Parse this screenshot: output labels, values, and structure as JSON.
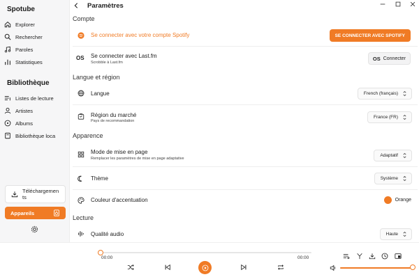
{
  "sidebar": {
    "app_title": "Spotube",
    "nav": [
      {
        "label": "Explorer",
        "icon": "home-icon"
      },
      {
        "label": "Rechercher",
        "icon": "search-icon"
      },
      {
        "label": "Paroles",
        "icon": "music-note-icon"
      },
      {
        "label": "Statistiques",
        "icon": "chart-icon"
      }
    ],
    "library_title": "Bibliothèque",
    "library": [
      {
        "label": "Listes de lecture",
        "icon": "list-icon"
      },
      {
        "label": "Artistes",
        "icon": "user-icon"
      },
      {
        "label": "Albums",
        "icon": "disc-icon"
      },
      {
        "label": "Bibliothèque loca",
        "icon": "folder-icon"
      }
    ],
    "downloads_label": "Téléchargemen ts",
    "devices_label": "Appareils"
  },
  "header": {
    "title": "Paramètres"
  },
  "sections": {
    "account": "Compte",
    "language": "Langue et région",
    "appearance": "Apparence",
    "playback": "Lecture"
  },
  "account": {
    "spotify_text": "Se connecter avec votre compte Spotify",
    "spotify_button": "SE CONNECTER AVEC SPOTIFY",
    "lastfm_title": "Se connecter avec Last.fm",
    "lastfm_sub": "Scrobble à Last.fm",
    "lastfm_button": "Connecter",
    "lastfm_logo": "OS"
  },
  "language": {
    "lang_label": "Langue",
    "lang_value": "French (français)",
    "market_label": "Région du marché",
    "market_sub": "Pays de recommandation",
    "market_value": "France (FR)"
  },
  "appearance": {
    "layout_label": "Mode de mise en page",
    "layout_sub": "Remplacer les paramètres de mise en page adaptative",
    "layout_value": "Adaptatif",
    "theme_label": "Thème",
    "theme_value": "Système",
    "accent_label": "Couleur d'accentuation",
    "accent_value": "Orange",
    "accent_color": "#f07b25"
  },
  "playback": {
    "quality_label": "Qualité audio",
    "quality_value": "Haute"
  },
  "player": {
    "time_current": "00:00",
    "time_total": "00:00",
    "progress": 0,
    "volume": 1.0
  },
  "colors": {
    "accent": "#f07b25"
  }
}
